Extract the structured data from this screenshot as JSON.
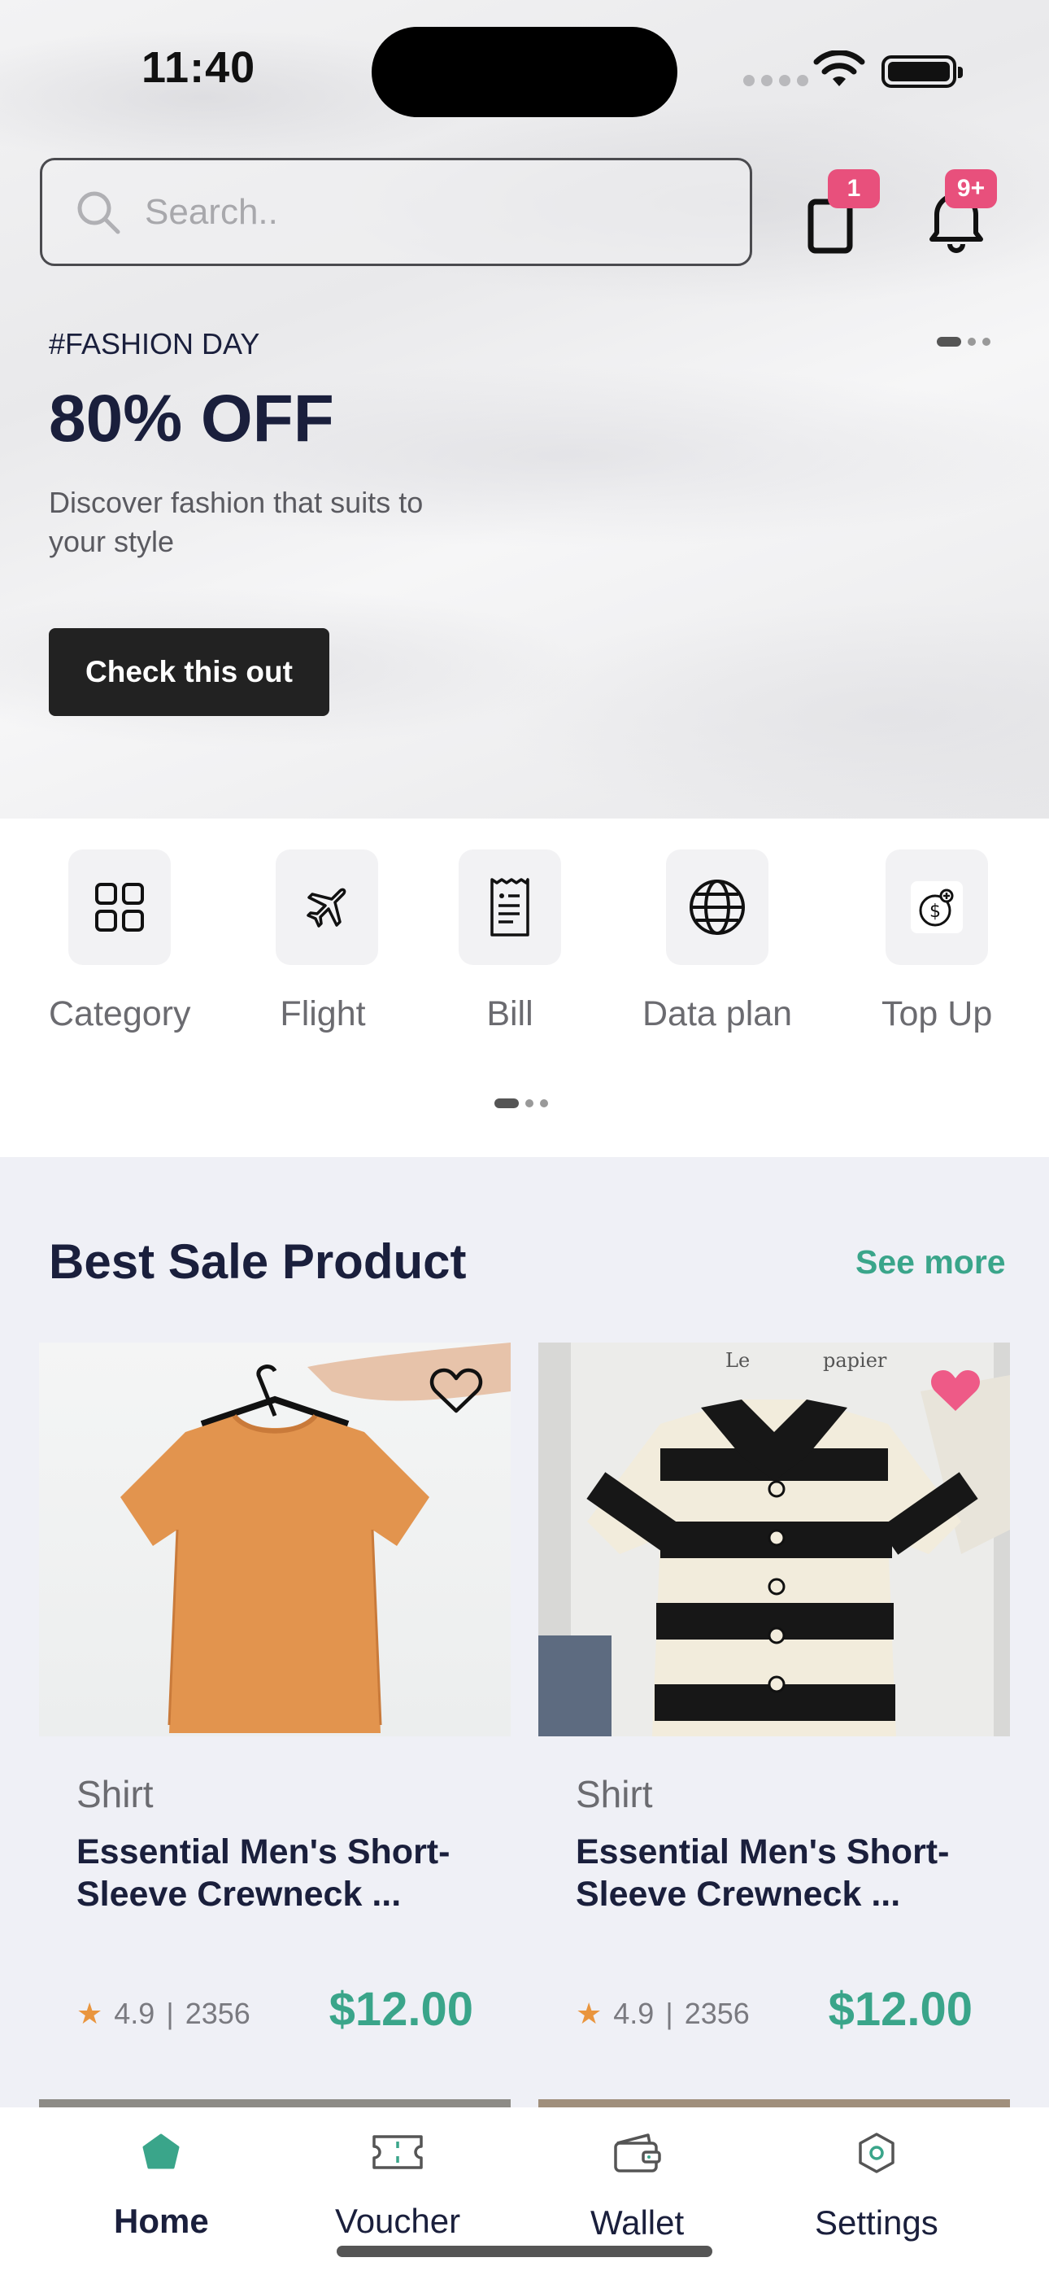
{
  "status_bar": {
    "time": "11:40"
  },
  "search": {
    "placeholder": "Search.."
  },
  "header": {
    "cart_badge": "1",
    "notification_badge": "9+"
  },
  "banner": {
    "tag": "#FASHION DAY",
    "title": "80% OFF",
    "description": "Discover fashion that suits to your style",
    "button_label": "Check this out",
    "page_indicator": {
      "pages": 3,
      "active": 1
    }
  },
  "services": {
    "items": [
      {
        "label": "Category",
        "icon": "grid-icon"
      },
      {
        "label": "Flight",
        "icon": "airplane-icon"
      },
      {
        "label": "Bill",
        "icon": "receipt-icon"
      },
      {
        "label": "Data plan",
        "icon": "globe-icon"
      },
      {
        "label": "Top Up",
        "icon": "dollar-coin-icon"
      }
    ],
    "page_indicator": {
      "pages": 3,
      "active": 1
    }
  },
  "best_sale": {
    "title": "Best Sale Product",
    "see_more": "See more",
    "products": [
      {
        "category": "Shirt",
        "name": "Essential Men's Short-Sleeve Crewneck ...",
        "rating": "4.9",
        "reviews": "2356",
        "price": "$12.00",
        "favorited": false
      },
      {
        "category": "Shirt",
        "name": "Essential Men's Short-Sleeve Crewneck ...",
        "rating": "4.9",
        "reviews": "2356",
        "price": "$12.00",
        "favorited": true
      }
    ]
  },
  "tabbar": {
    "tabs": [
      {
        "label": "Home",
        "icon": "home-icon",
        "active": true
      },
      {
        "label": "Voucher",
        "icon": "ticket-icon",
        "active": false
      },
      {
        "label": "Wallet",
        "icon": "wallet-icon",
        "active": false
      },
      {
        "label": "Settings",
        "icon": "settings-icon",
        "active": false
      }
    ]
  },
  "colors": {
    "accent": "#3aa58a",
    "badge": "#e8507c",
    "dark": "#1a1f3c",
    "button": "#222222"
  }
}
